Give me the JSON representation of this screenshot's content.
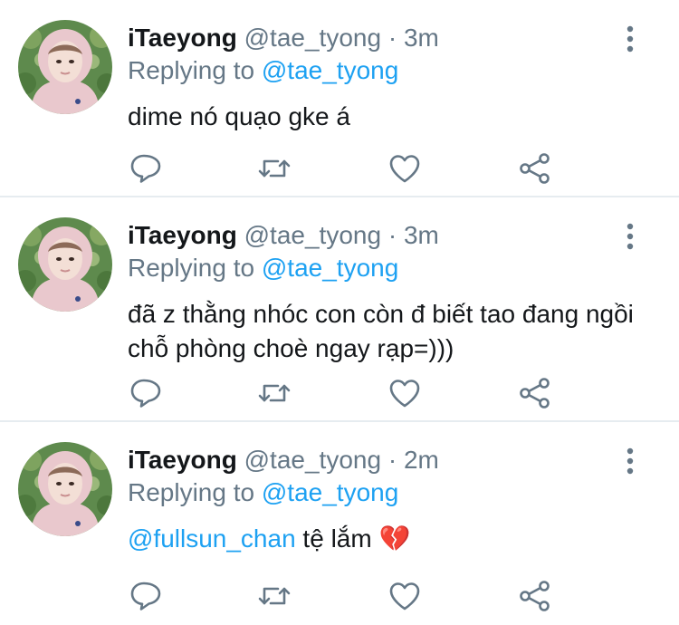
{
  "colors": {
    "name": "#14171a",
    "meta": "#657786",
    "link": "#1da1f2",
    "divider": "#e6ecf0",
    "avatar_bg": "#5e8a4d",
    "hoodie": "#e9c8cd"
  },
  "tweets": [
    {
      "author_name": "iTaeyong",
      "handle": "@tae_tyong",
      "separator": "·",
      "time": "3m",
      "replying_prefix": "Replying to",
      "replying_handle": "@tae_tyong",
      "body": "dime nó quạo gke á"
    },
    {
      "author_name": "iTaeyong",
      "handle": "@tae_tyong",
      "separator": "·",
      "time": "3m",
      "replying_prefix": "Replying to",
      "replying_handle": "@tae_tyong",
      "body": "đã z thằng nhóc con còn đ biết tao đang ngồi chỗ phòng choè ngay rạp=)))"
    },
    {
      "author_name": "iTaeyong",
      "handle": "@tae_tyong",
      "separator": "·",
      "time": "2m",
      "replying_prefix": "Replying to",
      "replying_handle": "@tae_tyong",
      "body_mention": "@fullsun_chan",
      "body": " tệ lắm",
      "body_emoji": "💔"
    }
  ],
  "icons": {
    "more": "more-vertical-icon",
    "reply": "reply-icon",
    "retweet": "retweet-icon",
    "like": "heart-icon",
    "share": "share-icon",
    "emoji": "broken-heart-icon"
  }
}
